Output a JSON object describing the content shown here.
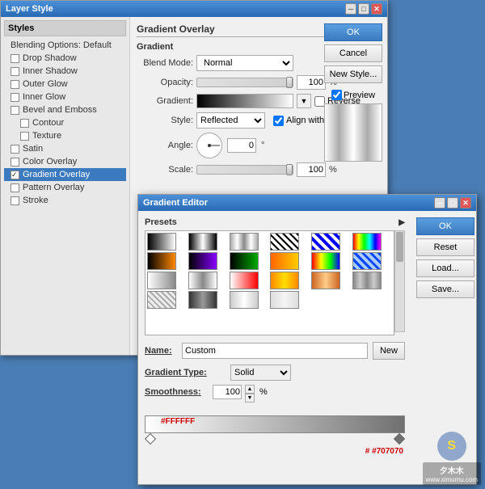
{
  "layerStyleWindow": {
    "title": "Layer Style",
    "sidebar": {
      "title": "Styles",
      "items": [
        {
          "id": "blending",
          "label": "Blending Options: Default",
          "hasCheckbox": false,
          "checked": false,
          "active": false,
          "bold": false
        },
        {
          "id": "drop-shadow",
          "label": "Drop Shadow",
          "hasCheckbox": true,
          "checked": false,
          "active": false,
          "bold": false
        },
        {
          "id": "inner-shadow",
          "label": "Inner Shadow",
          "hasCheckbox": true,
          "checked": false,
          "active": false,
          "bold": false
        },
        {
          "id": "outer-glow",
          "label": "Outer Glow",
          "hasCheckbox": true,
          "checked": false,
          "active": false,
          "bold": false
        },
        {
          "id": "inner-glow",
          "label": "Inner Glow",
          "hasCheckbox": true,
          "checked": false,
          "active": false,
          "bold": false
        },
        {
          "id": "bevel-emboss",
          "label": "Bevel and Emboss",
          "hasCheckbox": true,
          "checked": false,
          "active": false,
          "bold": false
        },
        {
          "id": "contour",
          "label": "Contour",
          "hasCheckbox": true,
          "checked": false,
          "active": false,
          "bold": false,
          "indent": true
        },
        {
          "id": "texture",
          "label": "Texture",
          "hasCheckbox": true,
          "checked": false,
          "active": false,
          "bold": false,
          "indent": true
        },
        {
          "id": "satin",
          "label": "Satin",
          "hasCheckbox": true,
          "checked": false,
          "active": false,
          "bold": false
        },
        {
          "id": "color-overlay",
          "label": "Color Overlay",
          "hasCheckbox": true,
          "checked": false,
          "active": false,
          "bold": false
        },
        {
          "id": "gradient-overlay",
          "label": "Gradient Overlay",
          "hasCheckbox": true,
          "checked": true,
          "active": true,
          "bold": false
        },
        {
          "id": "pattern-overlay",
          "label": "Pattern Overlay",
          "hasCheckbox": true,
          "checked": false,
          "active": false,
          "bold": false
        },
        {
          "id": "stroke",
          "label": "Stroke",
          "hasCheckbox": true,
          "checked": false,
          "active": false,
          "bold": false
        }
      ]
    },
    "buttons": {
      "ok": "OK",
      "cancel": "Cancel",
      "newStyle": "New Style...",
      "preview": "Preview"
    },
    "gradientOverlay": {
      "title": "Gradient Overlay",
      "subtitle": "Gradient",
      "blendMode": {
        "label": "Blend Mode:",
        "value": "Normal"
      },
      "opacity": {
        "label": "Opacity:",
        "value": "100",
        "unit": "%"
      },
      "gradient": {
        "label": "Gradient:"
      },
      "reverse": {
        "label": "Reverse"
      },
      "style": {
        "label": "Style:",
        "value": "Reflected"
      },
      "alignWithLayer": {
        "label": "Align with Layer"
      },
      "angle": {
        "label": "Angle:",
        "value": "0",
        "unit": "°"
      },
      "scale": {
        "label": "Scale:",
        "value": "100",
        "unit": "%"
      }
    }
  },
  "gradientEditor": {
    "title": "Gradient Editor",
    "buttons": {
      "ok": "OK",
      "reset": "Reset",
      "load": "Load...",
      "save": "Save..."
    },
    "presets": {
      "label": "Presets"
    },
    "name": {
      "label": "Name:",
      "value": "Custom",
      "newButton": "New"
    },
    "gradientType": {
      "label": "Gradient Type:",
      "value": "Solid"
    },
    "smoothness": {
      "label": "Smoothness:",
      "value": "100",
      "unit": "%"
    },
    "colorStops": {
      "leftColor": "#FFFFFF",
      "rightColor": "#707070",
      "leftLabel": "#FFFFFF",
      "rightLabel": "#707070"
    }
  },
  "watermark": {
    "line1": "夕木木",
    "line2": "www.ximumu.com",
    "circleText": "S"
  }
}
